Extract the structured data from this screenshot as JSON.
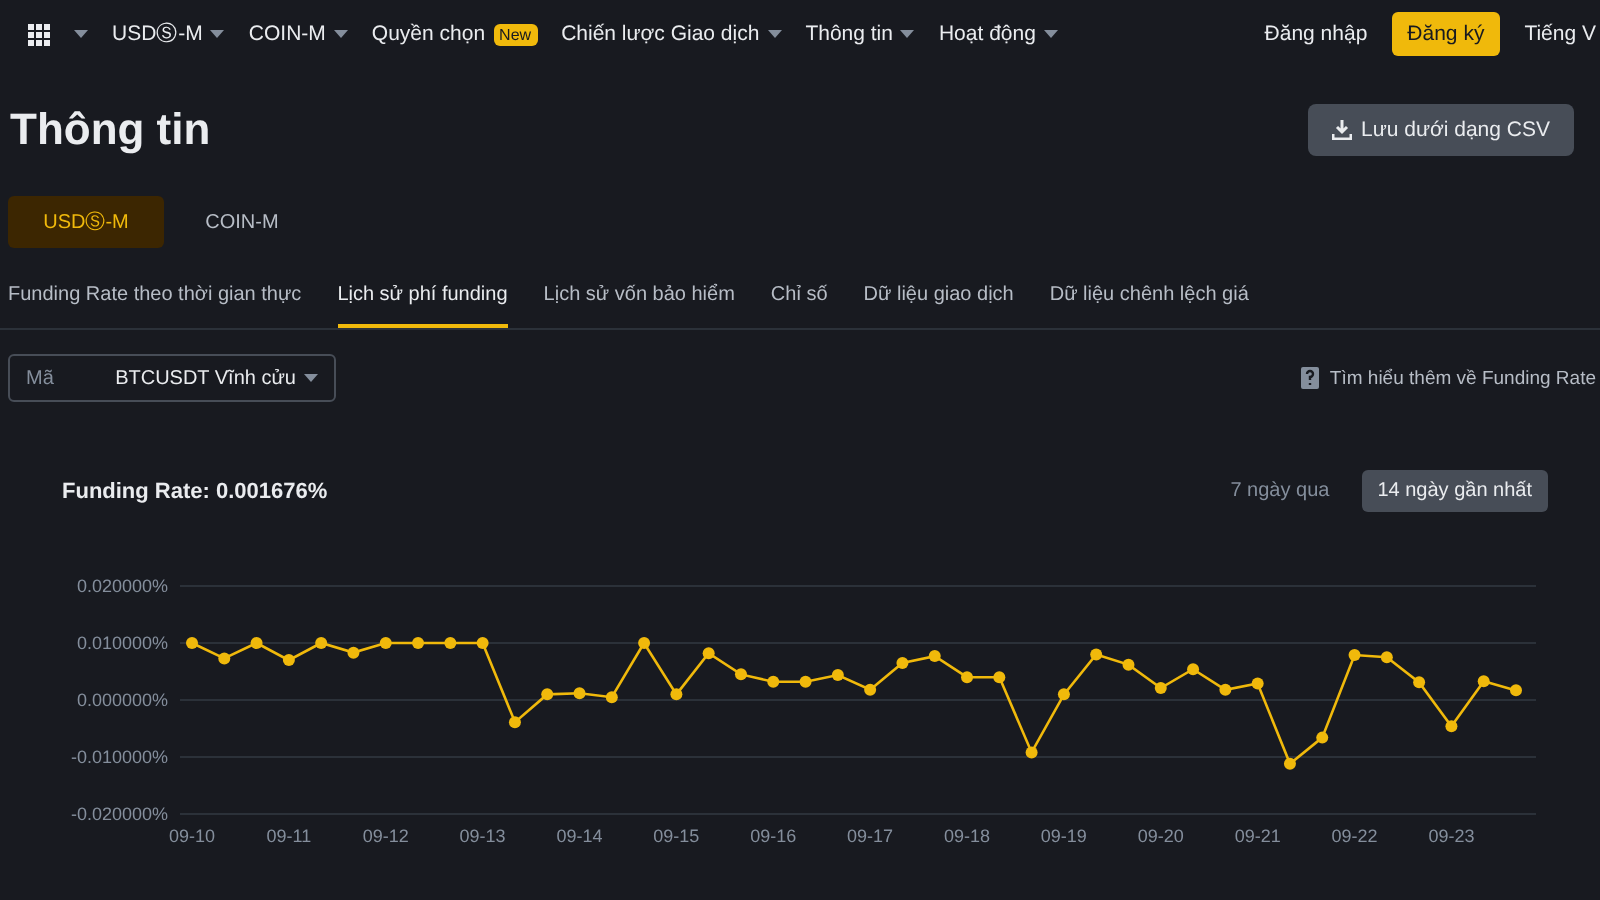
{
  "nav": {
    "items": [
      {
        "label": "USDⓈ-M",
        "caret": true
      },
      {
        "label": "COIN-M",
        "caret": true
      },
      {
        "label": "Quyền chọn",
        "badge": "New",
        "caret": false
      },
      {
        "label": "Chiến lược Giao dịch",
        "caret": true
      },
      {
        "label": "Thông tin",
        "caret": true
      },
      {
        "label": "Hoạt động",
        "caret": true
      }
    ],
    "login": "Đăng nhập",
    "register": "Đăng ký",
    "language": "Tiếng V"
  },
  "page_title": "Thông tin",
  "export_button": "Lưu dưới dạng CSV",
  "market_tabs": [
    {
      "label": "USDⓈ-M",
      "selected": true
    },
    {
      "label": "COIN-M",
      "selected": false
    }
  ],
  "sub_tabs": [
    {
      "label": "Funding Rate theo thời gian thực",
      "selected": false
    },
    {
      "label": "Lịch sử phí funding",
      "selected": true
    },
    {
      "label": "Lịch sử vốn bảo hiểm",
      "selected": false
    },
    {
      "label": "Chỉ số",
      "selected": false
    },
    {
      "label": "Dữ liệu giao dịch",
      "selected": false
    },
    {
      "label": "Dữ liệu chênh lệch giá",
      "selected": false
    }
  ],
  "symbol_select": {
    "label": "Mã",
    "value": "BTCUSDT Vĩnh cửu"
  },
  "learn_more": "Tìm hiểu thêm về Funding Rate",
  "chart": {
    "ranges": [
      {
        "label": "7 ngày qua",
        "selected": false
      },
      {
        "label": "14 ngày gần nhất",
        "selected": true
      }
    ],
    "chart_data": {
      "type": "line",
      "title": "Funding Rate: 0.001676%",
      "grid": true,
      "categories": [
        "09-10",
        null,
        null,
        "09-11",
        null,
        null,
        "09-12",
        null,
        null,
        "09-13",
        null,
        null,
        "09-14",
        null,
        null,
        "09-15",
        null,
        null,
        "09-16",
        null,
        null,
        "09-17",
        null,
        null,
        "09-18",
        null,
        null,
        "09-19",
        null,
        null,
        "09-20",
        null,
        null,
        "09-21",
        null,
        null,
        "09-22",
        null,
        null,
        "09-23",
        null,
        null
      ],
      "series": [
        {
          "color": "#f0b90b",
          "marker": "circle",
          "values": [
            0.01,
            0.0073,
            0.01,
            0.007,
            0.01,
            0.0083,
            0.01,
            0.01,
            0.01,
            0.01,
            -0.0039,
            0.001,
            0.0012,
            0.0005,
            0.01,
            0.001,
            0.0082,
            0.0045,
            0.0032,
            0.0032,
            0.0044,
            0.0018,
            0.0065,
            0.0077,
            0.004,
            0.004,
            -0.0092,
            0.001,
            0.008,
            0.0062,
            0.0021,
            0.0054,
            0.0018,
            0.0029,
            -0.0112,
            -0.0066,
            0.0079,
            0.0075,
            0.0031,
            -0.0046,
            0.0033,
            0.0017
          ]
        }
      ],
      "ylim": [
        -0.02,
        0.02
      ],
      "yticks": [
        {
          "value": 0.02,
          "label": "0.020000%"
        },
        {
          "value": 0.01,
          "label": "0.010000%"
        },
        {
          "value": 0,
          "label": "0.000000%"
        },
        {
          "value": -0.01,
          "label": "-0.010000%"
        },
        {
          "value": -0.02,
          "label": "-0.020000%"
        }
      ]
    }
  }
}
